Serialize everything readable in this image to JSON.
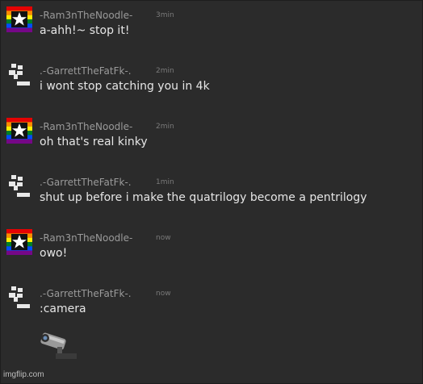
{
  "messages": [
    {
      "author": "-Ram3nTheNoodle-",
      "time": "3min",
      "text": "a-ahh!~ stop it!",
      "avatar": "rainbow-star-icon"
    },
    {
      "author": ".-GarrettTheFatFk-.",
      "time": "2min",
      "text": "i wont stop catching you in 4k",
      "avatar": "pixel-glyph-icon"
    },
    {
      "author": "-Ram3nTheNoodle-",
      "time": "2min",
      "text": "oh that's real kinky",
      "avatar": "rainbow-star-icon"
    },
    {
      "author": ".-GarrettTheFatFk-.",
      "time": "1min",
      "text": "shut up before i make the quatrilogy become a pentrilogy",
      "avatar": "pixel-glyph-icon"
    },
    {
      "author": "-Ram3nTheNoodle-",
      "time": "now",
      "text": "owo!",
      "avatar": "rainbow-star-icon"
    },
    {
      "author": ".-GarrettTheFatFk-.",
      "time": "now",
      "text": ":camera",
      "avatar": "pixel-glyph-icon"
    }
  ],
  "emoji": "security-camera-icon",
  "watermark": "imgflip.com",
  "colors": {
    "background": "#2b2b2b",
    "author": "#9a9a9a",
    "timestamp": "#7a7a7a",
    "message_text": "#e6e6e6"
  }
}
